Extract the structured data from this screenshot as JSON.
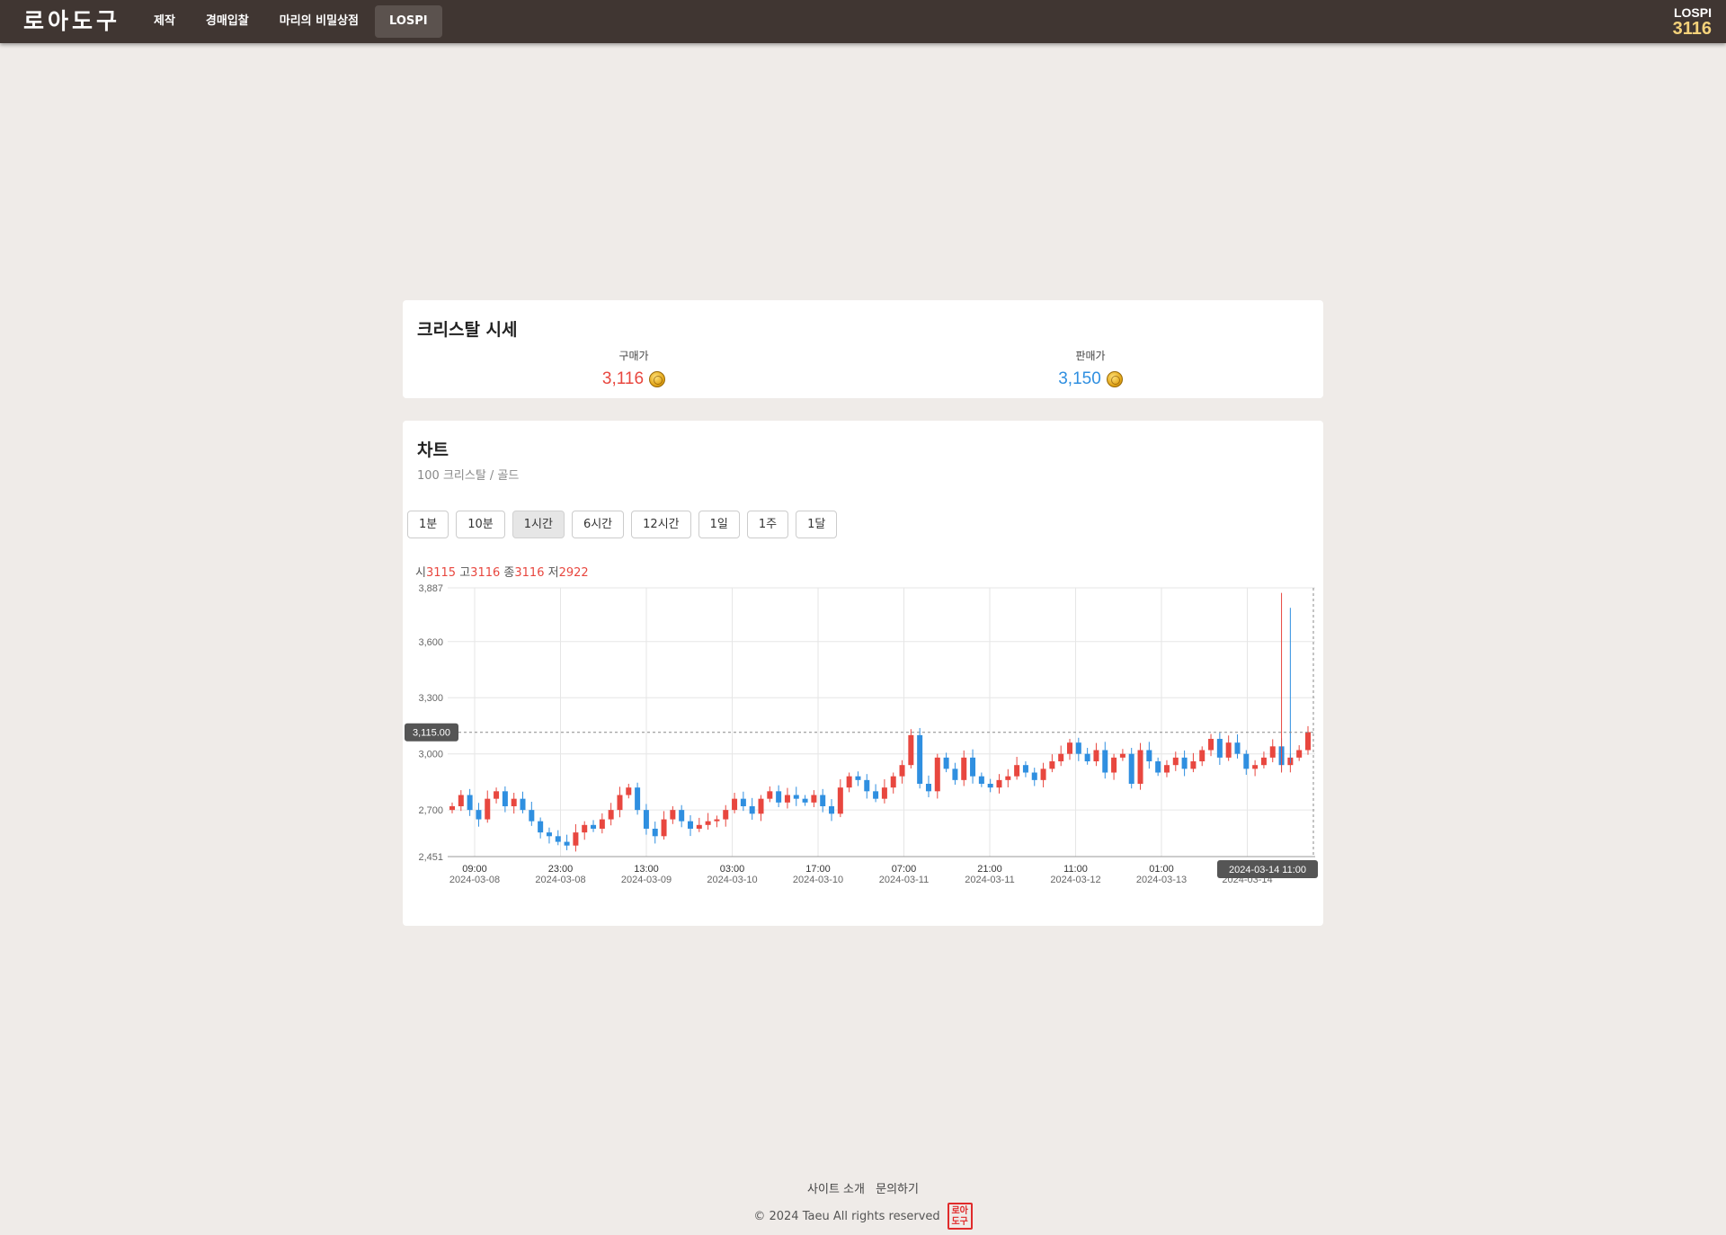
{
  "header": {
    "logo": "로아도구",
    "nav": [
      {
        "label": "제작"
      },
      {
        "label": "경매입찰"
      },
      {
        "label": "마리의 비밀상점"
      },
      {
        "label": "LOSPI",
        "active": true
      }
    ],
    "lospi_label": "LOSPI",
    "lospi_value": "3116",
    "accent_color": "#f4d27a"
  },
  "price": {
    "title": "크리스탈 시세",
    "buy_label": "구매가",
    "buy_value": "3,116",
    "buy_color": "#e8473f",
    "sell_label": "판매가",
    "sell_value": "3,150",
    "sell_color": "#2f8fe0",
    "coin_icon": "gold-coin-icon"
  },
  "chart": {
    "title": "차트",
    "subtitle": "100 크리스탈 / 골드",
    "tabs": [
      "1분",
      "10분",
      "1시간",
      "6시간",
      "12시간",
      "1일",
      "1주",
      "1달"
    ],
    "active_tab": "1시간",
    "ohlc": {
      "o_label": "시",
      "o": "3115",
      "h_label": "고",
      "h": "3116",
      "c_label": "종",
      "c": "3116",
      "l_label": "저",
      "l": "2922"
    },
    "crosshair_price": "3,115.00",
    "crosshair_time": "2024-03-14 11:00"
  },
  "chart_data": {
    "type": "candlestick",
    "up_color": "#e8473f",
    "down_color": "#2f8fe0",
    "y_ticks": [
      "3,887",
      "3,600",
      "3,300",
      "3,000",
      "2,700",
      "2,451"
    ],
    "y_range": [
      2451,
      3887
    ],
    "x_ticks": [
      {
        "time": "09:00",
        "date": "2024-03-08"
      },
      {
        "time": "23:00",
        "date": "2024-03-08"
      },
      {
        "time": "13:00",
        "date": "2024-03-09"
      },
      {
        "time": "03:00",
        "date": "2024-03-10"
      },
      {
        "time": "17:00",
        "date": "2024-03-10"
      },
      {
        "time": "07:00",
        "date": "2024-03-11"
      },
      {
        "time": "21:00",
        "date": "2024-03-11"
      },
      {
        "time": "11:00",
        "date": "2024-03-12"
      },
      {
        "time": "01:00",
        "date": "2024-03-13"
      },
      {
        "time": "",
        "date": "2024-03-14"
      }
    ],
    "closes": [
      2720,
      2780,
      2700,
      2650,
      2760,
      2800,
      2720,
      2760,
      2700,
      2640,
      2580,
      2560,
      2530,
      2510,
      2580,
      2620,
      2600,
      2650,
      2700,
      2780,
      2820,
      2700,
      2600,
      2560,
      2650,
      2700,
      2640,
      2600,
      2620,
      2640,
      2650,
      2700,
      2760,
      2720,
      2680,
      2760,
      2800,
      2740,
      2780,
      2760,
      2740,
      2780,
      2720,
      2680,
      2820,
      2880,
      2860,
      2800,
      2760,
      2820,
      2880,
      2940,
      3100,
      2840,
      2800,
      2980,
      2920,
      2860,
      2980,
      2880,
      2840,
      2820,
      2860,
      2880,
      2940,
      2900,
      2860,
      2920,
      2960,
      3000,
      3060,
      3000,
      2960,
      3020,
      2900,
      2980,
      3000,
      2840,
      3020,
      2960,
      2900,
      2940,
      2980,
      2920,
      2960,
      3020,
      3080,
      2980,
      3060,
      3000,
      2920,
      2940,
      2980,
      3040,
      2940,
      2980,
      3020,
      3116
    ]
  },
  "footer": {
    "about": "사이트 소개",
    "contact": "문의하기",
    "copyright": "© 2024 Taeu All rights reserved",
    "stamp": "로아도구"
  }
}
